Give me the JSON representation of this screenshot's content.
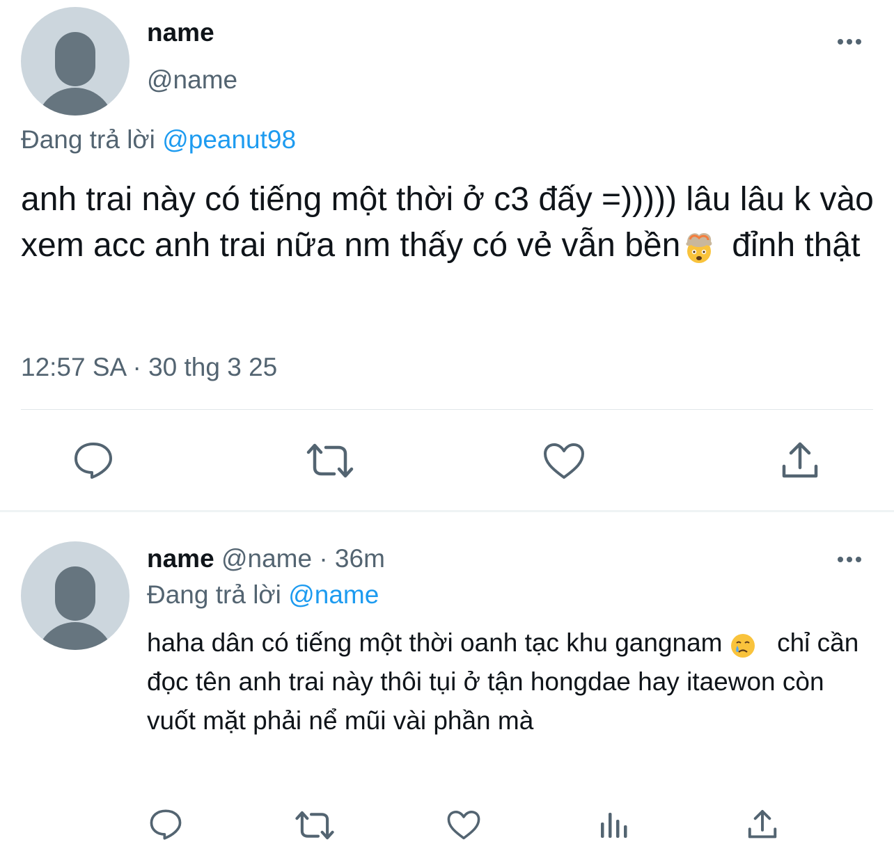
{
  "main_tweet": {
    "author_name": "name",
    "author_handle": "@name",
    "replying_prefix": "Đang trả lời",
    "replying_to": "@peanut98",
    "text_part1": "anh trai này có tiếng một thời ở c3 đấy =))))) lâu lâu k vào xem acc anh trai nữa nm thấy có vẻ vẫn bền",
    "text_part2": "đỉnh thật",
    "emoji": "exploding-head-emoji",
    "timestamp": "12:57 SA · 30 thg 3 25",
    "actions": [
      "reply-icon",
      "retweet-icon",
      "like-icon",
      "share-icon"
    ]
  },
  "reply_tweet": {
    "author_name": "name",
    "author_meta": "@name · 36m",
    "replying_prefix": "Đang trả lời",
    "replying_to": "@name",
    "text_part1": "haha dân có tiếng một thời oanh tạc khu gangnam",
    "text_part2": "chỉ cần đọc tên anh trai này thôi tụi ở tận hongdae hay itaewon còn vuốt mặt phải nể mũi vài phần mà",
    "emoji": "crying-face-emoji",
    "actions": [
      "reply-icon",
      "retweet-icon",
      "like-icon",
      "analytics-icon",
      "share-icon"
    ]
  },
  "colors": {
    "text": "#0f1419",
    "secondary": "#536471",
    "link": "#1d9bf0",
    "avatar_bg": "#ccd6dd",
    "avatar_fg": "#66757f"
  }
}
